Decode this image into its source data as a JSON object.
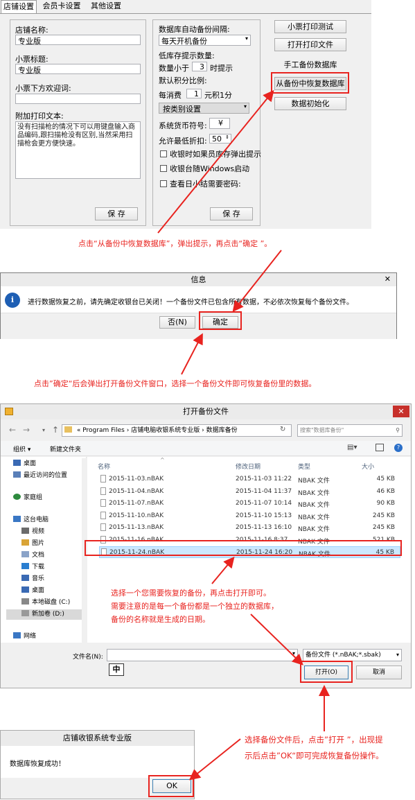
{
  "settings_panel": {
    "tabs": [
      "店铺设置",
      "会员卡设置",
      "其他设置"
    ],
    "left_group": {
      "store_name_label": "店铺名称:",
      "store_name_value": "专业版",
      "receipt_title_label": "小票标题:",
      "receipt_title_value": "专业版",
      "receipt_footer_label": "小票下方欢迎词:",
      "receipt_footer_value": "",
      "extra_text_label": "附加打印文本:",
      "extra_text_value": "没有扫描枪的情况下可以用键盘输入商品编码,跟扫描枪没有区别,当然采用扫描枪会更方便快速。",
      "save_label": "保 存"
    },
    "mid_group": {
      "backup_interval_label": "数据库自动备份间隔:",
      "backup_interval_value": "每天开机备份",
      "low_stock_label": "低库存提示数量:",
      "qty_less_label": "数量小于",
      "qty_less_value": "3",
      "qty_less_suffix": "时提示",
      "points_ratio_label": "默认积分比例:",
      "per_spend_label": "每消费",
      "per_spend_value": "1",
      "per_spend_suffix": "元积1分",
      "points_mode_value": "按类别设置",
      "currency_label": "系统货币符号:",
      "currency_value": "¥",
      "min_discount_label": "允许最低折扣:",
      "min_discount_value": "50",
      "chk1": "收银时如果员库存弹出提示",
      "chk2": "收银台随Windows启动",
      "chk3": "查看日小结需要密码:",
      "save_label": "保 存"
    },
    "right_buttons": {
      "print_test": "小票打印测试",
      "open_print_file": "打开打印文件",
      "manual_backup": "手工备份数据库",
      "restore_backup": "从备份中恢复数据库",
      "init_data": "数据初始化"
    }
  },
  "annotations": {
    "note1": "点击“从备份中恢复数据库”，弹出提示，再点击“确定 ”。",
    "note2": "点击”确定“后会弹出打开备份文件窗口，选择一个备份文件即可恢复备份里的数据。",
    "note3_lines": [
      "选择一个您需要恢复的备份，再点击打开即可。",
      "需要注意的是每一个备份都是一个独立的数据库，",
      "备份的名称就是生成的日期。"
    ],
    "note4_lines": [
      "选择备份文件后，点击”打开 ”，出现提",
      "示后点击”OK“即可完成恢复备份操作。"
    ]
  },
  "info_dialog": {
    "title": "信息",
    "close": "✕",
    "message": "进行数据恢复之前，请先确定收银台已关闭！一个备份文件已包含所有数据，不必依次恢复每个备份文件。",
    "no_label": "否(N)",
    "ok_label": "确定"
  },
  "open_dialog": {
    "title": "打开备份文件",
    "close": "✕",
    "breadcrumb": [
      "«",
      "Program Files",
      "›",
      "店铺电脑收银系统专业版",
      "›",
      "数据库备份"
    ],
    "search_placeholder": "搜索\"数据库备份\"",
    "organize": "组织 ▾",
    "new_folder": "新建文件夹",
    "columns": [
      "名称",
      "修改日期",
      "类型",
      "大小"
    ],
    "nav": [
      "桌面",
      "最近访问的位置",
      "家庭组",
      "这台电脑",
      "视频",
      "图片",
      "文档",
      "下载",
      "音乐",
      "桌面",
      "本地磁盘 (C:)",
      "新加卷 (D:)",
      "网络"
    ],
    "files": [
      {
        "name": "2015-11-03.nBAK",
        "date": "2015-11-03 11:22",
        "type": "NBAK 文件",
        "size": "45 KB"
      },
      {
        "name": "2015-11-04.nBAK",
        "date": "2015-11-04 11:37",
        "type": "NBAK 文件",
        "size": "46 KB"
      },
      {
        "name": "2015-11-07.nBAK",
        "date": "2015-11-07 10:14",
        "type": "NBAK 文件",
        "size": "90 KB"
      },
      {
        "name": "2015-11-10.nBAK",
        "date": "2015-11-10 15:13",
        "type": "NBAK 文件",
        "size": "245 KB"
      },
      {
        "name": "2015-11-13.nBAK",
        "date": "2015-11-13 16:10",
        "type": "NBAK 文件",
        "size": "245 KB"
      },
      {
        "name": "2015-11-16.nBAK",
        "date": "2015-11-16 8:37",
        "type": "NBAK 文件",
        "size": "521 KB"
      },
      {
        "name": "2015-11-24.nBAK",
        "date": "2015-11-24 16:20",
        "type": "NBAK 文件",
        "size": "45 KB"
      }
    ],
    "filename_label": "文件名(N):",
    "filename_value": "",
    "ime": "中",
    "filter_value": "备份文件 (*.nBAK;*.sbak)",
    "open_label": "打开(O)",
    "cancel_label": "取消"
  },
  "success_dialog": {
    "title": "店铺收银系统专业版",
    "message": "数据库恢复成功！",
    "ok_label": "OK"
  },
  "colors": {
    "accent_red": "#e8231f",
    "selection": "#cce8ff",
    "titlebar": "#ebebeb"
  }
}
